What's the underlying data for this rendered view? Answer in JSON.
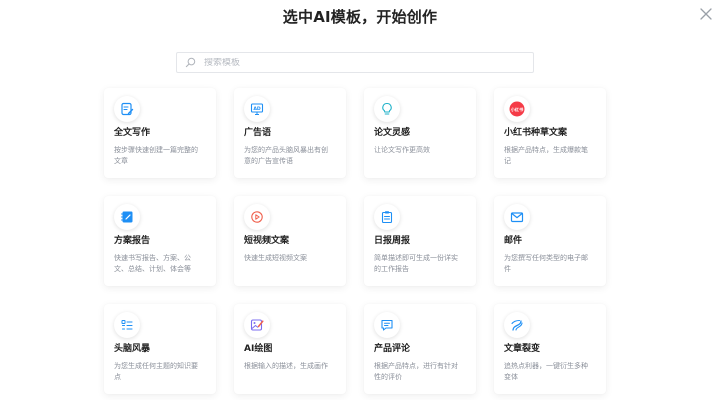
{
  "header": {
    "title": "选中AI模板，开始创作"
  },
  "search": {
    "placeholder": "搜索模板"
  },
  "colors": {
    "accent": "#1e8ff5",
    "red": "#f53b47",
    "card_bg": "#ffffff"
  },
  "templates": [
    {
      "title": "全文写作",
      "desc": "按步骤快速创建一篇完整的文章",
      "icon": "document-edit-icon"
    },
    {
      "title": "广告语",
      "desc": "为您的产品头脑风暴出有创意的广告宣传语",
      "icon": "ad-icon"
    },
    {
      "title": "论文灵感",
      "desc": "让论文写作更高效",
      "icon": "lightbulb-icon"
    },
    {
      "title": "小红书种草文案",
      "desc": "根据产品特点，生成爆款笔记",
      "icon": "xiaohongshu-icon",
      "icon_text": "小红书"
    },
    {
      "title": "方案报告",
      "desc": "快速书写报告、方案、公文、总结、计划、体会等",
      "icon": "notebook-icon"
    },
    {
      "title": "短视频文案",
      "desc": "快速生成短视频文案",
      "icon": "play-icon"
    },
    {
      "title": "日报周报",
      "desc": "简单描述即可生成一份详实的工作报告",
      "icon": "clipboard-icon"
    },
    {
      "title": "邮件",
      "desc": "为您撰写任何类型的电子邮件",
      "icon": "mail-icon"
    },
    {
      "title": "头脑风暴",
      "desc": "为您生成任何主题的知识要点",
      "icon": "list-icon"
    },
    {
      "title": "AI绘图",
      "desc": "根据输入的描述，生成画作",
      "icon": "image-brush-icon"
    },
    {
      "title": "产品评论",
      "desc": "根据产品特点，进行有针对性的评价",
      "icon": "comment-icon"
    },
    {
      "title": "文章裂变",
      "desc": "追热点利器，一键衍生多种变体",
      "icon": "split-icon"
    }
  ]
}
